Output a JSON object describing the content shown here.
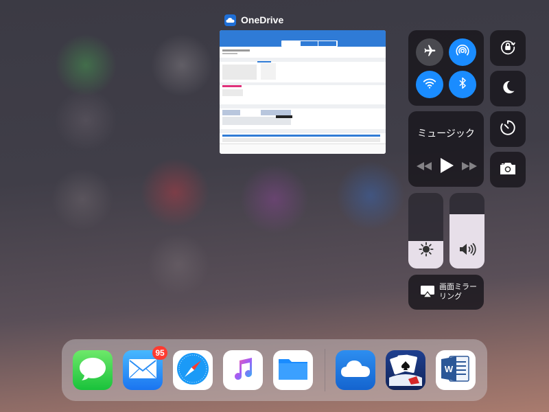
{
  "app_switcher": {
    "card_title": "OneDrive",
    "card_icon": "onedrive-icon"
  },
  "control_center": {
    "connectivity": [
      {
        "name": "airplane-mode",
        "icon": "airplane-icon",
        "state": "off"
      },
      {
        "name": "airdrop",
        "icon": "airdrop-icon",
        "state": "on"
      },
      {
        "name": "wifi",
        "icon": "wifi-icon",
        "state": "on"
      },
      {
        "name": "bluetooth",
        "icon": "bluetooth-icon",
        "state": "on"
      }
    ],
    "orientation_lock_icon": "rotation-lock-icon",
    "do_not_disturb_icon": "moon-icon",
    "timer_icon": "timer-icon",
    "camera_icon": "camera-icon",
    "music": {
      "title": "ミュージック",
      "controls": [
        "previous-icon",
        "play-icon",
        "next-icon"
      ]
    },
    "brightness": {
      "icon": "sun-icon",
      "level": 0.36
    },
    "volume": {
      "icon": "speaker-icon",
      "level": 0.72
    },
    "screen_mirroring": {
      "label_line1": "画面ミラー",
      "label_line2": "リング",
      "icon": "airplay-icon"
    }
  },
  "dock": {
    "apps": [
      {
        "name": "Messages",
        "icon": "messages-icon"
      },
      {
        "name": "Mail",
        "icon": "mail-icon",
        "badge": "95"
      },
      {
        "name": "Safari",
        "icon": "safari-icon"
      },
      {
        "name": "Music",
        "icon": "music-icon"
      },
      {
        "name": "Files",
        "icon": "files-icon"
      },
      {
        "name": "OneDrive",
        "icon": "onedrive-icon"
      },
      {
        "name": "Solitaire",
        "icon": "solitaire-icon"
      },
      {
        "name": "Word",
        "icon": "word-icon"
      }
    ]
  },
  "colors": {
    "accent_blue": "#1a8cff",
    "badge_red": "#ff3b30",
    "slider_fill": "#e7dfe9"
  }
}
